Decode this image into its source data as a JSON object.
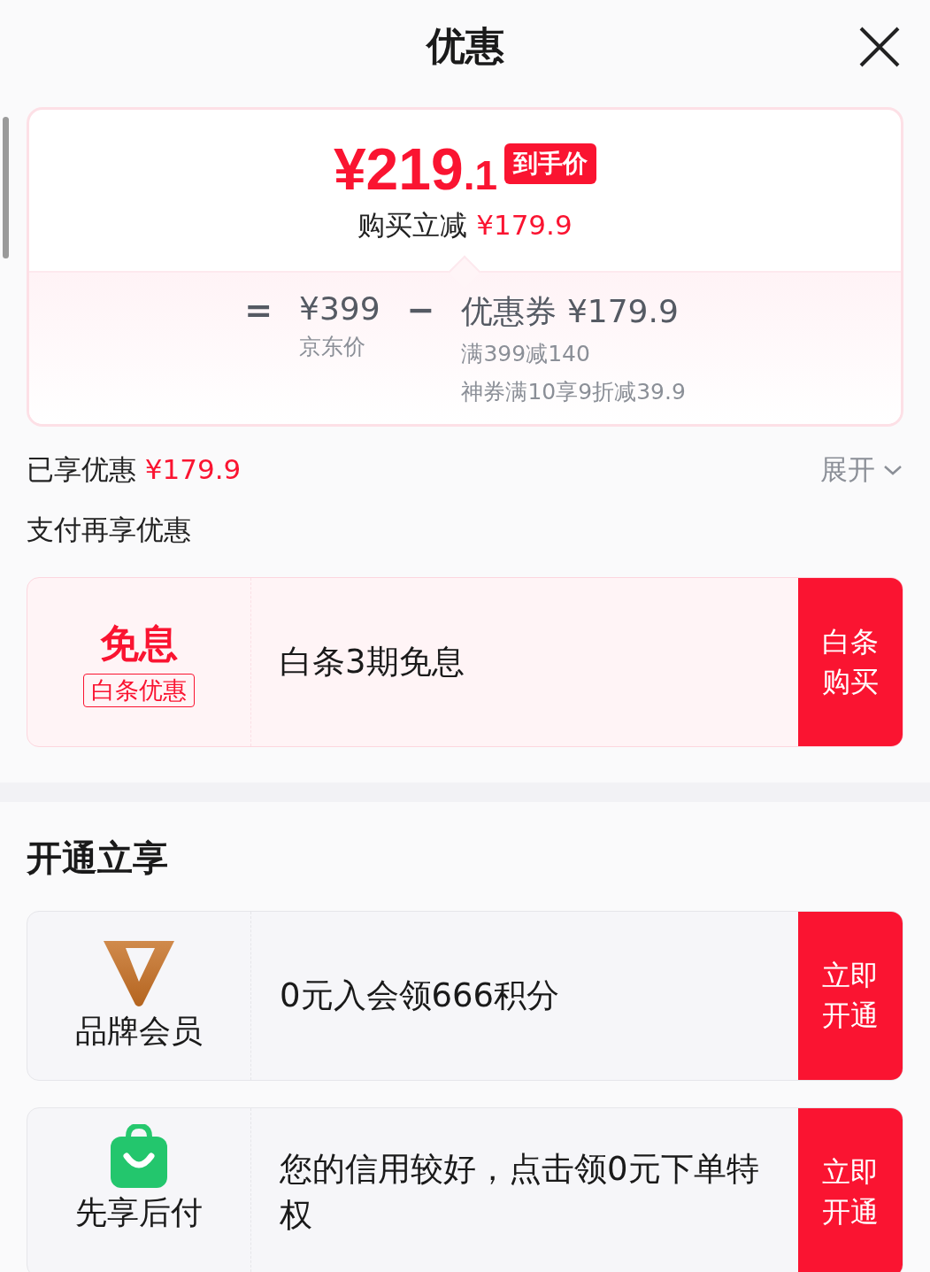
{
  "header": {
    "title": "优惠"
  },
  "price_card": {
    "final_price_symbol": "¥",
    "final_price_int": "219",
    "final_price_dec": ".1",
    "final_label": "到手价",
    "reduce_label": "购买立减",
    "reduce_amount": "¥179.9",
    "equals": "=",
    "base_price": "¥399",
    "base_label": "京东价",
    "minus": "−",
    "coupon_title": "优惠券 ¥179.9",
    "coupon_details": [
      "满399减140",
      "神券满10享9折减39.9"
    ]
  },
  "enjoyed": {
    "label": "已享优惠",
    "amount": "¥179.9",
    "toggle": "展开",
    "expanded": false
  },
  "pay_section": {
    "title": "支付再享优惠"
  },
  "pay_offers": [
    {
      "kind": "tag",
      "title": "免息",
      "tag": "白条优惠",
      "text": "白条3期免息",
      "action": "白条购买"
    }
  ],
  "open_section": {
    "title": "开通立享"
  },
  "open_offers": [
    {
      "kind": "v-logo",
      "label": "品牌会员",
      "text": "0元入会领666积分",
      "action": "立即开通"
    },
    {
      "kind": "bag",
      "label": "先享后付",
      "text": "您的信用较好，点击领0元下单特权",
      "action": "立即开通"
    }
  ]
}
